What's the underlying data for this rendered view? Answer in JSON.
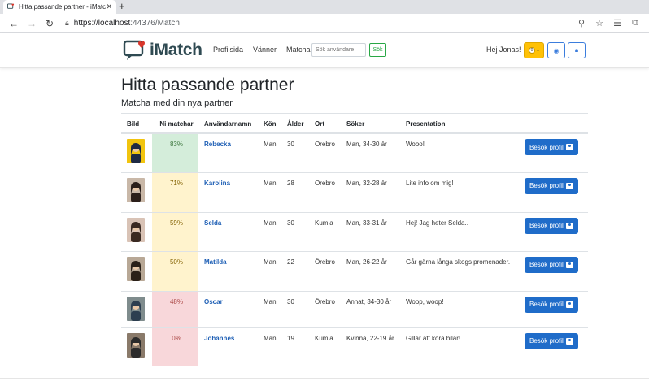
{
  "browser": {
    "tab_title": "Hitta passande partner - iMatch",
    "url_host": "https://localhost",
    "url_rest": ":44376/Match"
  },
  "navbar": {
    "brand": "iMatch",
    "links": [
      "Profilsida",
      "Vänner",
      "Matcha"
    ],
    "search_placeholder": "Sök användare",
    "search_button": "Sök",
    "greeting": "Hej Jonas!",
    "coin_label": "0"
  },
  "page": {
    "title": "Hitta passande partner",
    "subtitle": "Matcha med din nya partner"
  },
  "table": {
    "headers": [
      "Bild",
      "Ni matchar",
      "Användarnamn",
      "Kön",
      "Ålder",
      "Ort",
      "Söker",
      "Presentation",
      ""
    ],
    "rows": [
      {
        "match": "83%",
        "username": "Rebecka",
        "gender": "Man",
        "age": "30",
        "city": "Örebro",
        "seeking": "Man, 34-30 år",
        "presentation": "Wooo!",
        "button": "Besök profil",
        "match_color": "#d4edda",
        "text_color": "#3c763d"
      },
      {
        "match": "71%",
        "username": "Karolina",
        "gender": "Man",
        "age": "28",
        "city": "Örebro",
        "seeking": "Man, 32-28 år",
        "presentation": "Lite info om mig!",
        "button": "Besök profil",
        "match_color": "#fff3cd",
        "text_color": "#856404"
      },
      {
        "match": "59%",
        "username": "Selda",
        "gender": "Man",
        "age": "30",
        "city": "Kumla",
        "seeking": "Man, 33-31 år",
        "presentation": "Hej! Jag heter Selda..",
        "button": "Besök profil",
        "match_color": "#fff3cd",
        "text_color": "#856404"
      },
      {
        "match": "50%",
        "username": "Matilda",
        "gender": "Man",
        "age": "22",
        "city": "Örebro",
        "seeking": "Man, 26-22 år",
        "presentation": "Går gärna långa skogs promenader.",
        "button": "Besök profil",
        "match_color": "#fff3cd",
        "text_color": "#856404"
      },
      {
        "match": "48%",
        "username": "Oscar",
        "gender": "Man",
        "age": "30",
        "city": "Örebro",
        "seeking": "Annat, 34-30 år",
        "presentation": "Woop, woop!",
        "button": "Besök profil",
        "match_color": "#f8d7da",
        "text_color": "#a94442"
      },
      {
        "match": "0%",
        "username": "Johannes",
        "gender": "Man",
        "age": "19",
        "city": "Kumla",
        "seeking": "Kvinna, 22-19 år",
        "presentation": "Gillar att köra bilar!",
        "button": "Besök profil",
        "match_color": "#f8d7da",
        "text_color": "#a94442"
      }
    ]
  },
  "colors": {
    "brand": "#2f4a52",
    "primary": "#1f6cc9",
    "warning": "#ffc107",
    "success": "#28a745"
  }
}
